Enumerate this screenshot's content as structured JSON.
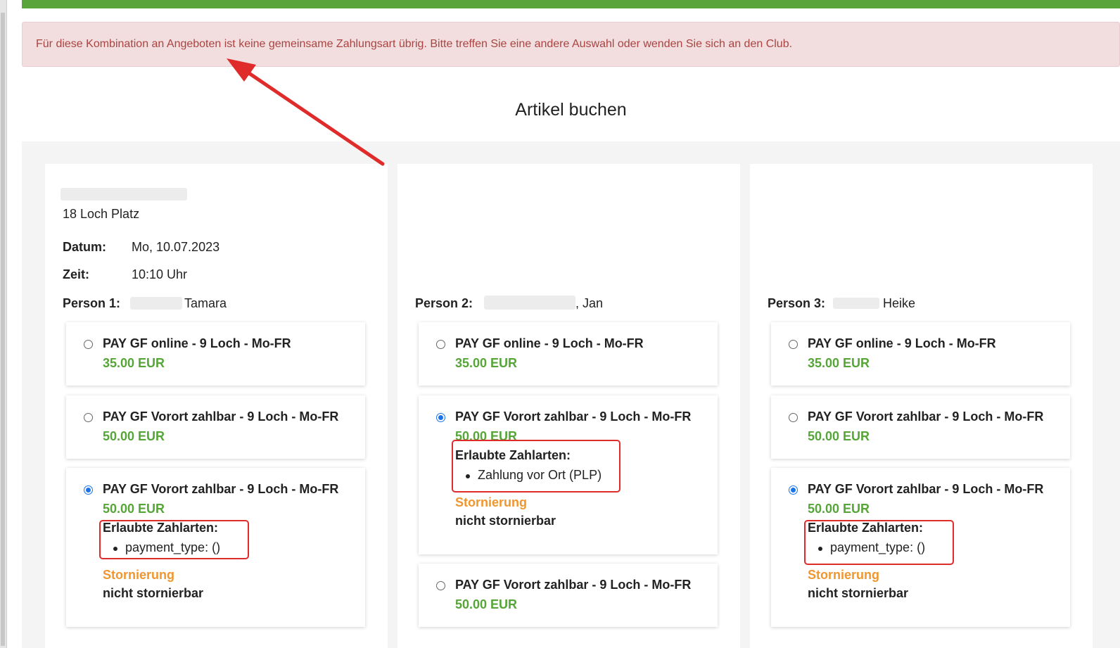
{
  "alert": {
    "message": "Für diese Kombination an Angeboten ist keine gemeinsame Zahlungsart übrig. Bitte treffen Sie eine andere Auswahl oder wenden Sie sich an den Club."
  },
  "page": {
    "title": "Artikel buchen"
  },
  "booking": {
    "course": "18 Loch Platz",
    "date_label": "Datum:",
    "date_value": "Mo, 10.07.2023",
    "time_label": "Zeit:",
    "time_value": "10:10 Uhr"
  },
  "persons": [
    {
      "label": "Person 1:",
      "name": "Tamara",
      "offers": [
        {
          "name": "PAY GF online - 9 Loch - Mo-FR",
          "price": "35.00 EUR",
          "selected": false
        },
        {
          "name": "PAY GF Vorort zahlbar - 9 Loch - Mo-FR",
          "price": "50.00 EUR",
          "selected": false
        },
        {
          "name": "PAY GF Vorort zahlbar - 9 Loch - Mo-FR",
          "price": "50.00 EUR",
          "selected": true,
          "payment_title": "Erlaubte Zahlarten:",
          "payment_item": "payment_type: ()",
          "cancel_title": "Stornierung",
          "cancel_value": "nicht stornierbar"
        }
      ]
    },
    {
      "label": "Person 2:",
      "name": ", Jan",
      "offers": [
        {
          "name": "PAY GF online - 9 Loch - Mo-FR",
          "price": "35.00 EUR",
          "selected": false
        },
        {
          "name": "PAY GF Vorort zahlbar - 9 Loch - Mo-FR",
          "price": "50.00 EUR",
          "selected": true,
          "payment_title": "Erlaubte Zahlarten:",
          "payment_item": "Zahlung vor Ort (PLP)",
          "cancel_title": "Stornierung",
          "cancel_value": "nicht stornierbar"
        },
        {
          "name": "PAY GF Vorort zahlbar - 9 Loch - Mo-FR",
          "price": "50.00 EUR",
          "selected": false
        }
      ]
    },
    {
      "label": "Person 3:",
      "name": "Heike",
      "offers": [
        {
          "name": "PAY GF online - 9 Loch - Mo-FR",
          "price": "35.00 EUR",
          "selected": false
        },
        {
          "name": "PAY GF Vorort zahlbar - 9 Loch - Mo-FR",
          "price": "50.00 EUR",
          "selected": false
        },
        {
          "name": "PAY GF Vorort zahlbar - 9 Loch - Mo-FR",
          "price": "50.00 EUR",
          "selected": true,
          "payment_title": "Erlaubte Zahlarten:",
          "payment_item": "payment_type: ()",
          "cancel_title": "Stornierung",
          "cancel_value": "nicht stornierbar"
        }
      ]
    }
  ],
  "colors": {
    "accent_green": "#5aa53b",
    "price_green": "#56a537",
    "alert_bg": "#f2dede",
    "alert_text": "#a94442",
    "cancel_orange": "#f0962f",
    "annotation_red": "#e02b2b",
    "radio_blue": "#1a73e8"
  }
}
